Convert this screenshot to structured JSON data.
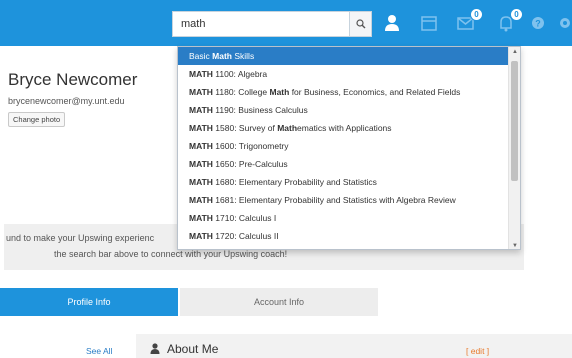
{
  "colors": {
    "topbar": "#1e93dc",
    "dropdown_active": "#2a7dc6",
    "edit_link": "#e8792b"
  },
  "header": {
    "search_value": "math",
    "icons": [
      {
        "name": "user-icon"
      },
      {
        "name": "calendar-icon"
      },
      {
        "name": "messages-icon",
        "badge": "0"
      },
      {
        "name": "notifications-icon",
        "badge": "0"
      },
      {
        "name": "help-icon"
      },
      {
        "name": "settings-icon"
      }
    ]
  },
  "dropdown": {
    "items": [
      {
        "prefix": "Basic ",
        "bold": "Math",
        "suffix": " Skills",
        "active": true
      },
      {
        "prefix": "",
        "bold": "MATH",
        "suffix": " 1100: Algebra"
      },
      {
        "prefix": "",
        "bold": "MATH",
        "suffix": " 1180: College ",
        "bold2": "Math",
        "suffix2": " for Business, Economics, and Related Fields"
      },
      {
        "prefix": "",
        "bold": "MATH",
        "suffix": " 1190: Business Calculus"
      },
      {
        "prefix": "",
        "bold": "MATH",
        "suffix": " 1580: Survey of ",
        "bold2": "Math",
        "suffix2": "ematics with Applications"
      },
      {
        "prefix": "",
        "bold": "MATH",
        "suffix": " 1600: Trigonometry"
      },
      {
        "prefix": "",
        "bold": "MATH",
        "suffix": " 1650: Pre-Calculus"
      },
      {
        "prefix": "",
        "bold": "MATH",
        "suffix": " 1680: Elementary Probability and Statistics"
      },
      {
        "prefix": "",
        "bold": "MATH",
        "suffix": " 1681: Elementary Probability and Statistics with Algebra Review"
      },
      {
        "prefix": "",
        "bold": "MATH",
        "suffix": " 1710: Calculus I"
      },
      {
        "prefix": "",
        "bold": "MATH",
        "suffix": " 1720: Calculus II"
      }
    ]
  },
  "profile": {
    "name": "Bryce Newcomer",
    "email": "brycenewcomer@my.unt.edu",
    "change_photo": "Change photo",
    "info_line1": "und to make your Upswing experienc",
    "info_line2": "the search bar above to connect with your Upswing coach!"
  },
  "tabs": {
    "profile": "Profile Info",
    "account": "Account Info"
  },
  "bottom": {
    "see_all": "See All",
    "about_me": "About Me",
    "edit": "[ edit ]"
  }
}
